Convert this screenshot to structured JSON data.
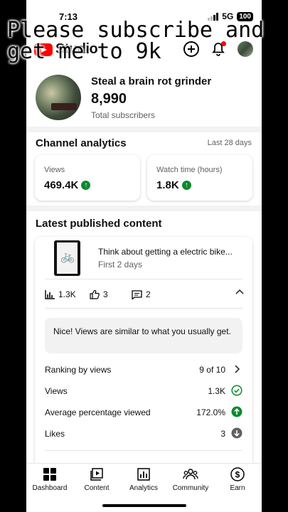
{
  "status_bar": {
    "time": "7:13",
    "network": "5G",
    "battery": "100"
  },
  "header": {
    "logo_text": "Studio"
  },
  "overlay_caption": "Please subscribe and\nget me to 9k",
  "channel": {
    "name": "Steal a brain rot grinder",
    "subscribers": "8,990",
    "subscribers_label": "Total subscribers"
  },
  "analytics": {
    "title": "Channel analytics",
    "period": "Last 28 days",
    "cards": [
      {
        "label": "Views",
        "value": "469.4K",
        "trend": "up"
      },
      {
        "label": "Watch time (hours)",
        "value": "1.8K",
        "trend": "up"
      }
    ]
  },
  "latest": {
    "title": "Latest published content",
    "video_title": "Think about getting a electric bike...",
    "video_sub": "First 2 days",
    "stats": {
      "views": "1.3K",
      "likes": "3",
      "comments": "2"
    },
    "insight": "Nice! Views are similar to what you usually get.",
    "rows": [
      {
        "label": "Ranking by views",
        "value": "9 of 10",
        "icon": "chevron-right-icon"
      },
      {
        "label": "Views",
        "value": "1.3K",
        "icon": "check-circle-icon"
      },
      {
        "label": "Average percentage viewed",
        "value": "172.0%",
        "icon": "arrow-up-circle-icon"
      },
      {
        "label": "Likes",
        "value": "3",
        "icon": "arrow-down-circle-icon"
      }
    ]
  },
  "nav": [
    {
      "label": "Dashboard",
      "icon": "dashboard-icon",
      "active": true
    },
    {
      "label": "Content",
      "icon": "content-icon"
    },
    {
      "label": "Analytics",
      "icon": "analytics-icon"
    },
    {
      "label": "Community",
      "icon": "community-icon"
    },
    {
      "label": "Earn",
      "icon": "earn-icon"
    }
  ],
  "colors": {
    "accent_red": "#ff0000",
    "trend_up": "#0a8a2e",
    "trend_down": "#606060"
  }
}
